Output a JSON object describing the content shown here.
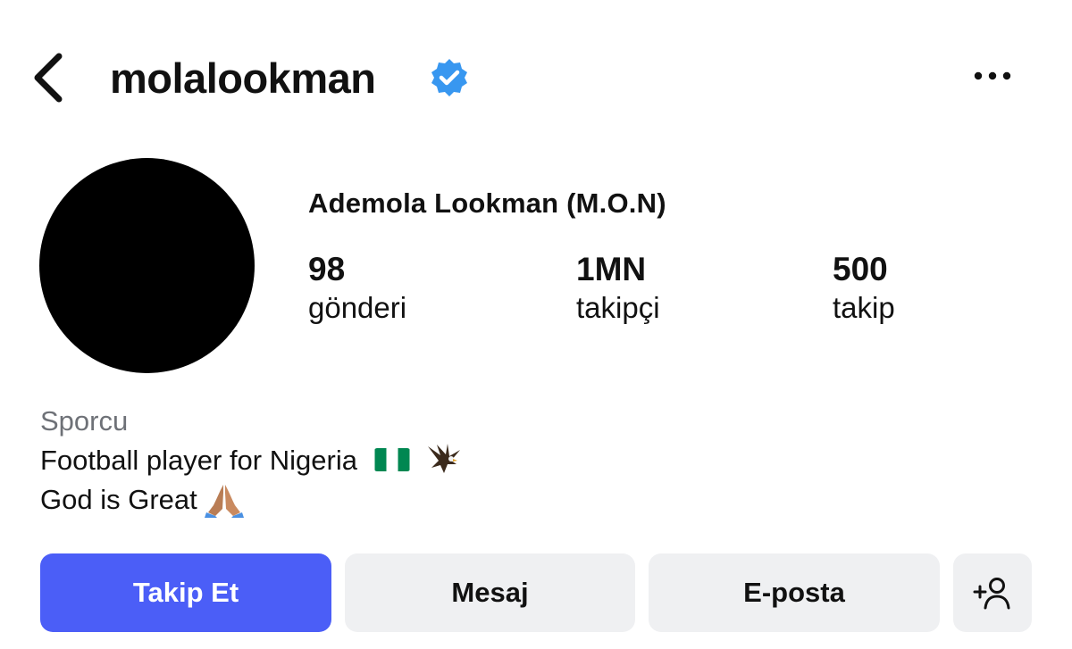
{
  "header": {
    "username": "molalookman",
    "verified": true
  },
  "profile": {
    "full_name": "Ademola Lookman (M.O.N)",
    "stats": [
      {
        "value": "98",
        "label": "gönderi"
      },
      {
        "value": "1MN",
        "label": "takipçi"
      },
      {
        "value": "500",
        "label": "takip"
      }
    ],
    "category": "Sporcu",
    "bio_line1": "Football player for Nigeria",
    "bio_line2": "God is Great"
  },
  "actions": {
    "follow": "Takip Et",
    "message": "Mesaj",
    "email": "E-posta"
  },
  "icons": {
    "back": "chevron-left-icon",
    "verified": "verified-badge-icon",
    "more": "more-horizontal-icon",
    "add_user": "add-user-icon",
    "flag": "nigeria-flag-icon",
    "eagle": "eagle-icon",
    "pray": "folded-hands-icon"
  },
  "colors": {
    "accent": "#4b5ef7",
    "verified": "#3897f0",
    "secondary_button": "#eff0f2",
    "muted_text": "#6e7177"
  }
}
